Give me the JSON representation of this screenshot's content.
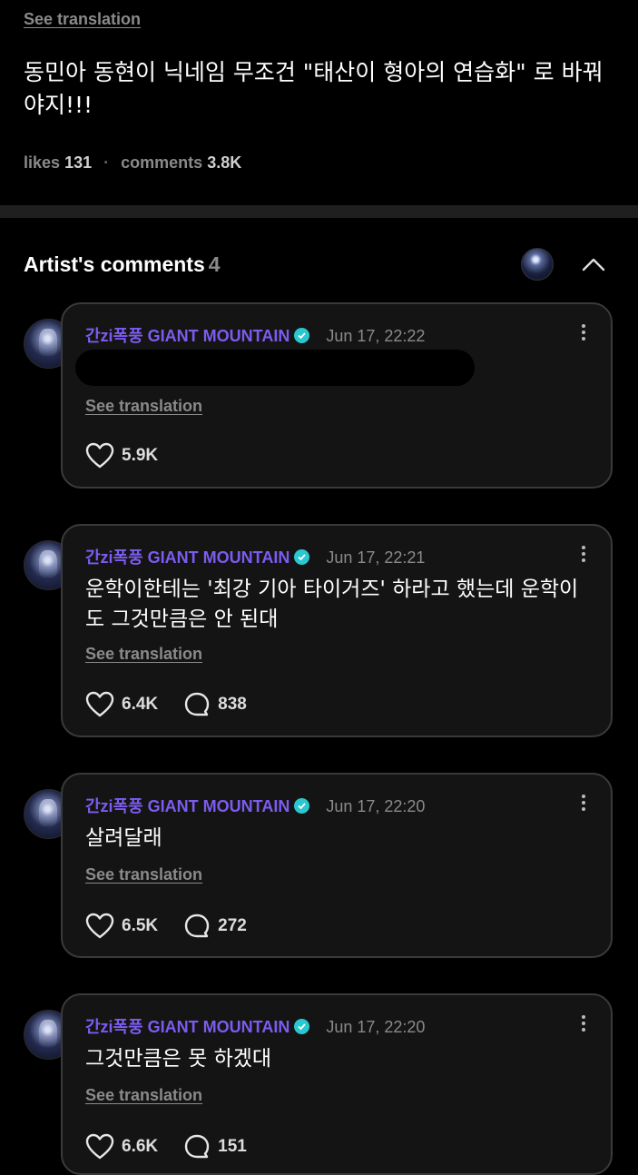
{
  "post": {
    "see_translation": "See translation",
    "body": "동민아 동현이 닉네임 무조건 \"태산이 형아의 연습화\" 로 바꿔야지!!!",
    "likes_label": "likes",
    "likes_count": "131",
    "comments_label": "comments",
    "comments_count": "3.8K"
  },
  "section": {
    "title": "Artist's comments",
    "count": "4"
  },
  "comments": [
    {
      "author": "간zi폭풍 GIANT MOUNTAIN",
      "time": "Jun 17, 22:22",
      "text": "",
      "see_translation": "See translation",
      "likes": "5.9K",
      "replies": ""
    },
    {
      "author": "간zi폭풍 GIANT MOUNTAIN",
      "time": "Jun 17, 22:21",
      "text": "운학이한테는 '최강 기아 타이거즈' 하라고 했는데 운학이도 그것만큼은 안 된대",
      "see_translation": "See translation",
      "likes": "6.4K",
      "replies": "838"
    },
    {
      "author": "간zi폭풍 GIANT MOUNTAIN",
      "time": "Jun 17, 22:20",
      "text": "살려달래",
      "see_translation": "See translation",
      "likes": "6.5K",
      "replies": "272"
    },
    {
      "author": "간zi폭풍 GIANT MOUNTAIN",
      "time": "Jun 17, 22:20",
      "text": "그것만큼은 못 하겠대",
      "see_translation": "See translation",
      "likes": "6.6K",
      "replies": "151"
    }
  ],
  "icons": {
    "like": "heart-icon",
    "reply": "comment-bubble-icon",
    "verified": "verified-check-icon",
    "more": "more-vertical-icon",
    "collapse": "chevron-up-icon"
  },
  "colors": {
    "background": "#000000",
    "card": "#141414",
    "author": "#7c5cf0",
    "verified": "#2bc7d0",
    "muted": "#8a8a8a"
  }
}
